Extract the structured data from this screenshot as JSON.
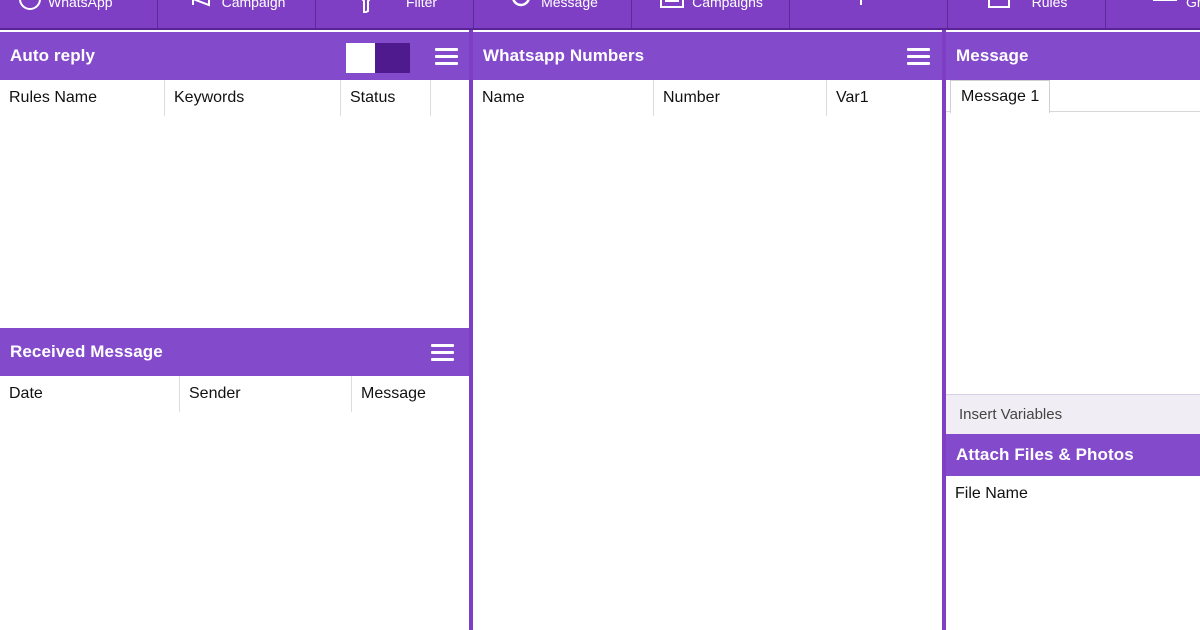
{
  "toolbar": {
    "buttons": [
      {
        "label": "WhatsApp",
        "icon": "whatsapp-icon"
      },
      {
        "label": "Campaign",
        "icon": "megaphone-icon"
      },
      {
        "label": "Filter",
        "icon": "filter-icon"
      },
      {
        "label": "Message",
        "icon": "message-icon"
      },
      {
        "label": "Campaigns",
        "icon": "campaigns-icon"
      },
      {
        "label": "",
        "icon": "auto-reply-icon"
      },
      {
        "label": "Rules",
        "icon": "rules-icon"
      },
      {
        "label": "Grab",
        "icon": "grabber-icon"
      }
    ]
  },
  "auto_reply": {
    "title": "Auto reply",
    "columns": [
      "Rules Name",
      "Keywords",
      "Status"
    ]
  },
  "received_message": {
    "title": "Received Message",
    "columns": [
      "Date",
      "Sender",
      "Message"
    ]
  },
  "whatsapp_numbers": {
    "title": "Whatsapp Numbers",
    "columns": [
      "Name",
      "Number",
      "Var1"
    ]
  },
  "message": {
    "title": "Message",
    "tab": "Message 1",
    "insert_variables": "Insert Variables"
  },
  "attach": {
    "title": "Attach Files & Photos",
    "columns": [
      "File Name"
    ]
  },
  "colors": {
    "accent": "#834bcb",
    "dark_accent": "#4f1a8d",
    "toolbar": "#7e3fc4"
  }
}
